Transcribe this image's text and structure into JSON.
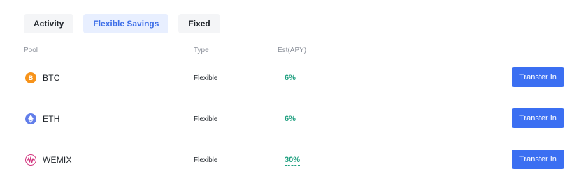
{
  "tabs": [
    {
      "label": "Activity",
      "active": false
    },
    {
      "label": "Flexible Savings",
      "active": true
    },
    {
      "label": "Fixed",
      "active": false
    }
  ],
  "table": {
    "headers": {
      "pool": "Pool",
      "type": "Type",
      "apy": "Est(APY)"
    },
    "rows": [
      {
        "coin": "BTC",
        "icon": "bitcoin-icon",
        "icon_glyph": "B",
        "type": "Flexible",
        "apy": "6%",
        "action": "Transfer In"
      },
      {
        "coin": "ETH",
        "icon": "ethereum-icon",
        "icon_glyph": "",
        "type": "Flexible",
        "apy": "6%",
        "action": "Transfer In"
      },
      {
        "coin": "WEMIX",
        "icon": "wemix-icon",
        "icon_glyph": "",
        "type": "Flexible",
        "apy": "30%",
        "action": "Transfer In"
      }
    ]
  },
  "colors": {
    "accent": "#3b6ff2",
    "active_tab_bg": "#e8efff",
    "active_tab_text": "#3d6ee8",
    "apy_green": "#20a080",
    "btc_orange": "#f7931a",
    "eth_blue": "#627eea",
    "wemix_pink": "#d2357e"
  }
}
